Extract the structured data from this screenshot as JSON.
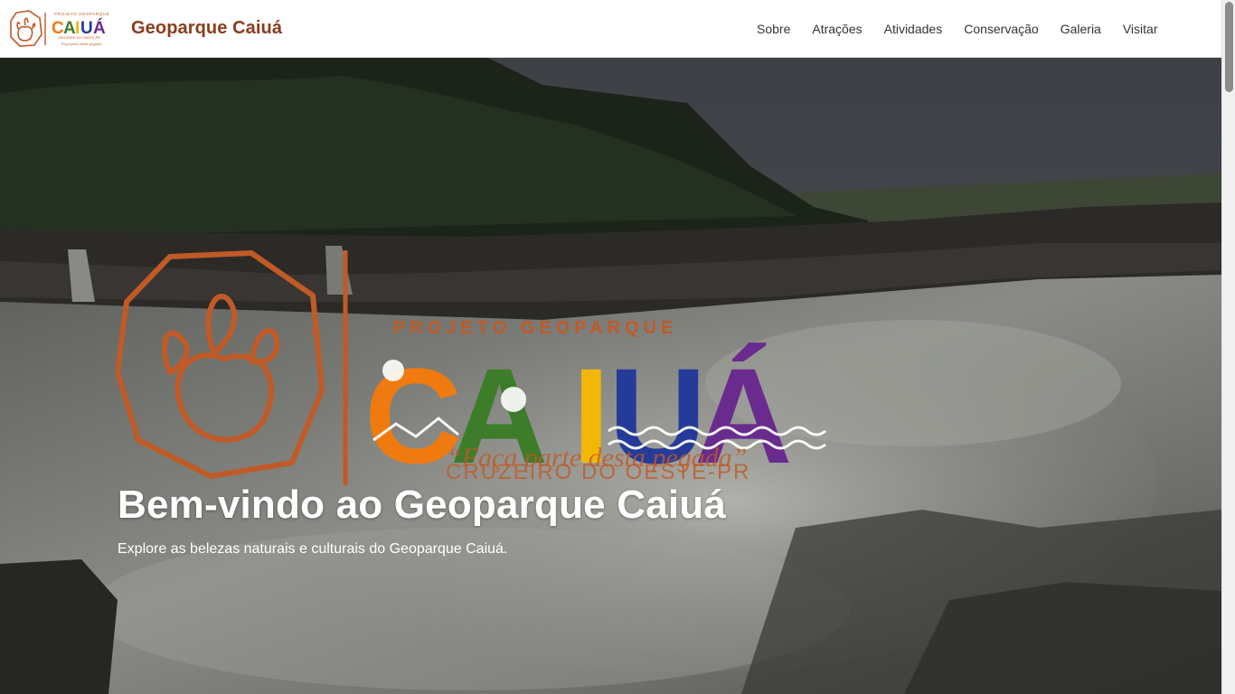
{
  "header": {
    "brand_title": "Geoparque Caiuá",
    "nav": [
      {
        "label": "Sobre"
      },
      {
        "label": "Atrações"
      },
      {
        "label": "Atividades"
      },
      {
        "label": "Conservação"
      },
      {
        "label": "Galeria"
      },
      {
        "label": "Visitar"
      }
    ]
  },
  "logo": {
    "top_text": "PROJETO GEOPARQUE",
    "name": "CAIUÁ",
    "location": "CRUZEIRO DO OESTE-PR",
    "tagline": "“Faça parte desta pegada”",
    "icon": "footprint-icon"
  },
  "hero": {
    "title": "Bem-vindo ao Geoparque Caiuá",
    "subtitle": "Explore as belezas naturais e culturais do Geoparque Caiuá."
  },
  "colors": {
    "brand_brown": "#8a3d1c",
    "logo_copper": "#c05a27",
    "orange": "#ef7a10",
    "green": "#3d7d2a",
    "yellow": "#f2b705",
    "blue": "#243b9a",
    "purple": "#6a2b8f"
  }
}
